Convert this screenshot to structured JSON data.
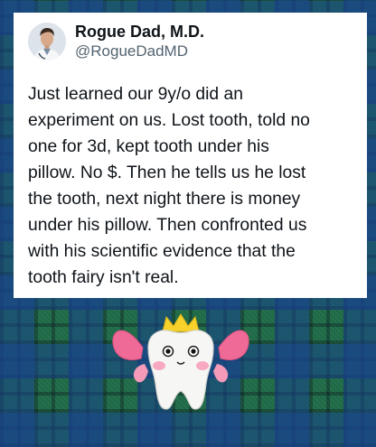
{
  "tweet": {
    "display_name": "Rogue Dad, M.D.",
    "handle": "@RogueDadMD",
    "text": "Just learned our 9y/o did an\nexperiment on us.  Lost tooth, told no\none for 3d, kept tooth under his\npillow.  No $.  Then he tells us he lost\nthe tooth, next night there is money\nunder his pillow.  Then confronted us\nwith his scientific evidence that the\ntooth fairy isn't real."
  },
  "colors": {
    "text_primary": "#0f1419",
    "text_secondary": "#536471",
    "background_plaid_green": "#1f6a47",
    "background_plaid_blue": "#18428c",
    "fairy_wing_pink": "#f06a97",
    "crown_yellow": "#f7d22a"
  },
  "icons": {
    "avatar": "doctor-avatar",
    "decoration": "tooth-fairy-plush"
  }
}
